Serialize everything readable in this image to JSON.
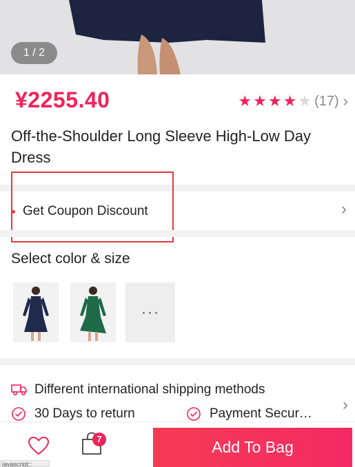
{
  "gallery": {
    "counter": "1 / 2"
  },
  "product": {
    "price": "¥2255.40",
    "rating": {
      "value": 4,
      "max": 5,
      "review_count": "(17)"
    },
    "title": "Off-the-Shoulder Long Sleeve High-Low Day Dress"
  },
  "coupon": {
    "label": "Get Coupon Discount"
  },
  "variants": {
    "label": "Select color & size",
    "thumbnails": [
      {
        "color": "navy",
        "hex": "#1f2a4d"
      },
      {
        "color": "green",
        "hex": "#1d6b47"
      }
    ],
    "more": "···"
  },
  "info": {
    "shipping": "Different international shipping methods",
    "returns": "30 Days to return",
    "payment": "Payment Secur…"
  },
  "bottom_bar": {
    "bag_count": "7",
    "add_to_bag": "Add To Bag",
    "status_text": "javascript:;"
  },
  "colors": {
    "accent": "#f0235a",
    "highlight_box": "#e23b3b"
  }
}
